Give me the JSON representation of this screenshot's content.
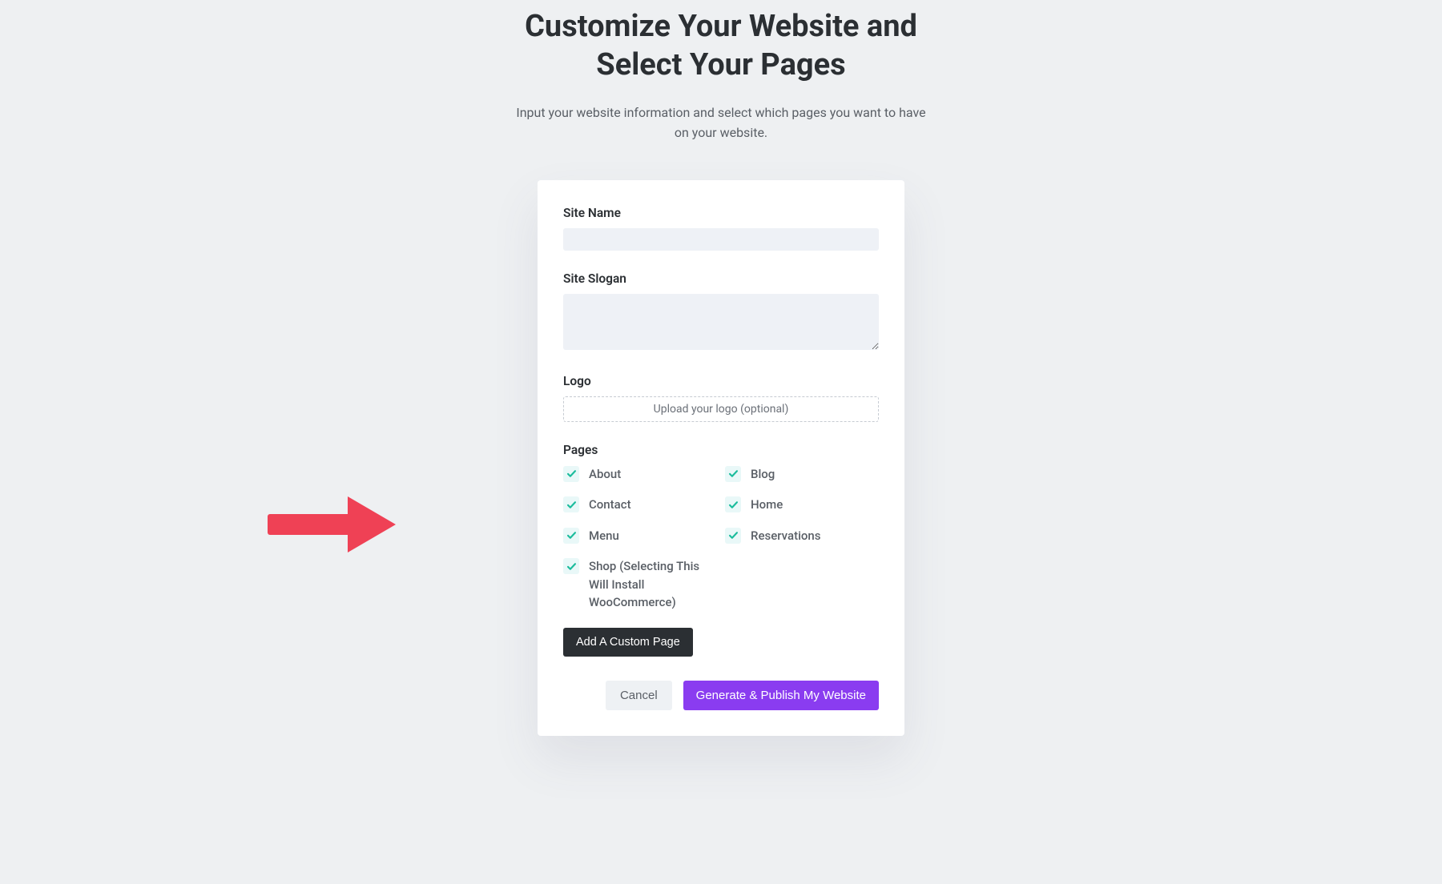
{
  "header": {
    "title_line1": "Customize Your Website and",
    "title_line2": "Select Your Pages",
    "subtitle": "Input your website information and select which pages you want to have on your website."
  },
  "form": {
    "site_name": {
      "label": "Site Name",
      "value": ""
    },
    "site_slogan": {
      "label": "Site Slogan",
      "value": ""
    },
    "logo": {
      "label": "Logo",
      "upload_text": "Upload your logo (optional)"
    },
    "pages": {
      "label": "Pages",
      "items": [
        {
          "label": "About",
          "checked": true
        },
        {
          "label": "Blog",
          "checked": true
        },
        {
          "label": "Contact",
          "checked": true
        },
        {
          "label": "Home",
          "checked": true
        },
        {
          "label": "Menu",
          "checked": true
        },
        {
          "label": "Reservations",
          "checked": true
        },
        {
          "label": "Shop (Selecting This Will Install WooCommerce)",
          "checked": true
        }
      ]
    },
    "add_custom_label": "Add A Custom Page",
    "cancel_label": "Cancel",
    "submit_label": "Generate & Publish My Website"
  },
  "annotation": {
    "arrow_color": "#ef4155"
  }
}
